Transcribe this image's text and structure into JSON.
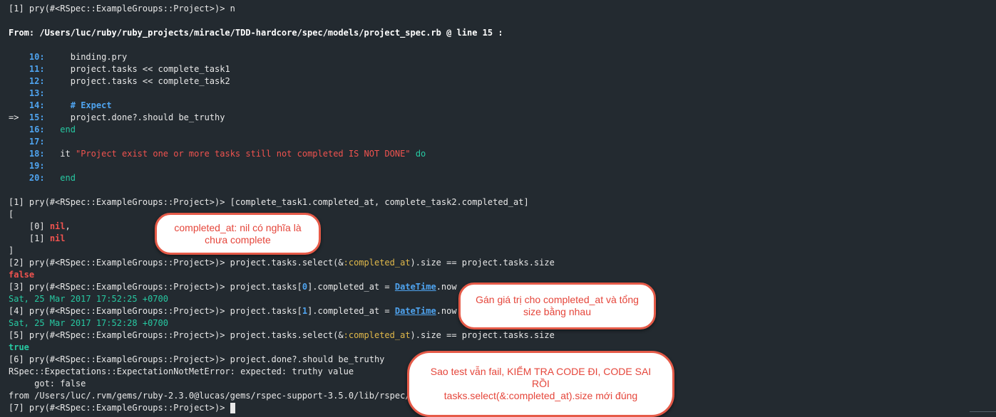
{
  "terminal": {
    "prompt_1": "[1] pry(#<RSpec::ExampleGroups::Project>)> ",
    "cmd_n": "n",
    "from_label": "From:",
    "from_path": " /Users/luc/ruby/ruby_projects/miracle/TDD-hardcore/spec/models/project_spec.rb @ line 15 :",
    "source": [
      {
        "num": "10:",
        "marker": "   ",
        "text": "    binding.pry"
      },
      {
        "num": "11:",
        "marker": "   ",
        "text": "    project.tasks << complete_task1"
      },
      {
        "num": "12:",
        "marker": "   ",
        "text": "    project.tasks << complete_task2"
      },
      {
        "num": "13:",
        "marker": "   ",
        "text": ""
      },
      {
        "num": "14:",
        "marker": "   ",
        "text": "    # Expect"
      },
      {
        "num": "15:",
        "marker": "=> ",
        "text": "    project.done?.should be_truthy"
      },
      {
        "num": "16:",
        "marker": "   ",
        "text": "  end"
      },
      {
        "num": "17:",
        "marker": "   ",
        "text": ""
      },
      {
        "num": "18:",
        "marker": "   ",
        "text": "  it \"Project exist one or more tasks still not completed IS NOT DONE\" do"
      },
      {
        "num": "19:",
        "marker": "   ",
        "text": ""
      },
      {
        "num": "20:",
        "marker": "   ",
        "text": "  end"
      }
    ],
    "cmd_1": "[complete_task1.completed_at, complete_task2.completed_at]",
    "open_bracket": "[",
    "item_0_index": "[0] ",
    "item_0_value": "nil",
    "item_0_comma": ",",
    "item_1_index": "[1] ",
    "item_1_value": "nil",
    "close_bracket": "]",
    "prompt_2": "[2] pry(#<RSpec::ExampleGroups::Project>)> ",
    "cmd_2a": "project.tasks.select(&",
    "cmd_2_sym": ":completed_at",
    "cmd_2b": ").size == project.tasks.size",
    "result_2": "false",
    "prompt_3": "[3] pry(#<RSpec::ExampleGroups::Project>)> ",
    "cmd_3a": "project.tasks[",
    "cmd_3_idx": "0",
    "cmd_3b": "].completed_at = ",
    "cmd_3_cls": "DateTime",
    "cmd_3c": ".now",
    "result_3": "Sat, 25 Mar 2017 17:52:25 +0700",
    "prompt_4": "[4] pry(#<RSpec::ExampleGroups::Project>)> ",
    "cmd_4a": "project.tasks[",
    "cmd_4_idx": "1",
    "cmd_4b": "].completed_at = ",
    "cmd_4_cls": "DateTime",
    "cmd_4c": ".now",
    "result_4": "Sat, 25 Mar 2017 17:52:28 +0700",
    "prompt_5": "[5] pry(#<RSpec::ExampleGroups::Project>)> ",
    "cmd_5a": "project.tasks.select(&",
    "cmd_5_sym": ":completed_at",
    "cmd_5b": ").size == project.tasks.size",
    "result_5": "true",
    "prompt_6": "[6] pry(#<RSpec::ExampleGroups::Project>)> ",
    "cmd_6": "project.done?.should be_truthy",
    "error_line": "RSpec::Expectations::ExpectationNotMetError: expected: truthy value",
    "got_line": "     got: false",
    "from_gem": "from /Users/luc/.rvm/gems/ruby-2.3.0@lucas/gems/rspec-support-3.5.0/lib/rspec/sup",
    "prompt_7": "[7] pry(#<RSpec::ExampleGroups::Project>)> "
  },
  "annotations": {
    "bubble_1": [
      "completed_at: nil có nghĩa là",
      "chưa complete"
    ],
    "bubble_2": [
      "Gán giá trị cho completed_at và tổng",
      "size bằng nhau"
    ],
    "bubble_3": [
      "Sao test vẫn fail, KIỂM TRA CODE ĐI, CODE SAI",
      "RỒI",
      "tasks.select(&:completed_at).size mới đúng"
    ]
  },
  "colors": {
    "background": "#232a30",
    "foreground": "#e8e8e8",
    "line_number": "#4fa4f0",
    "keyword": "#27c9a2",
    "string": "#f0534f",
    "symbol": "#e0b84a",
    "bubble_border": "#e55a48",
    "bubble_text": "#e5453a"
  }
}
